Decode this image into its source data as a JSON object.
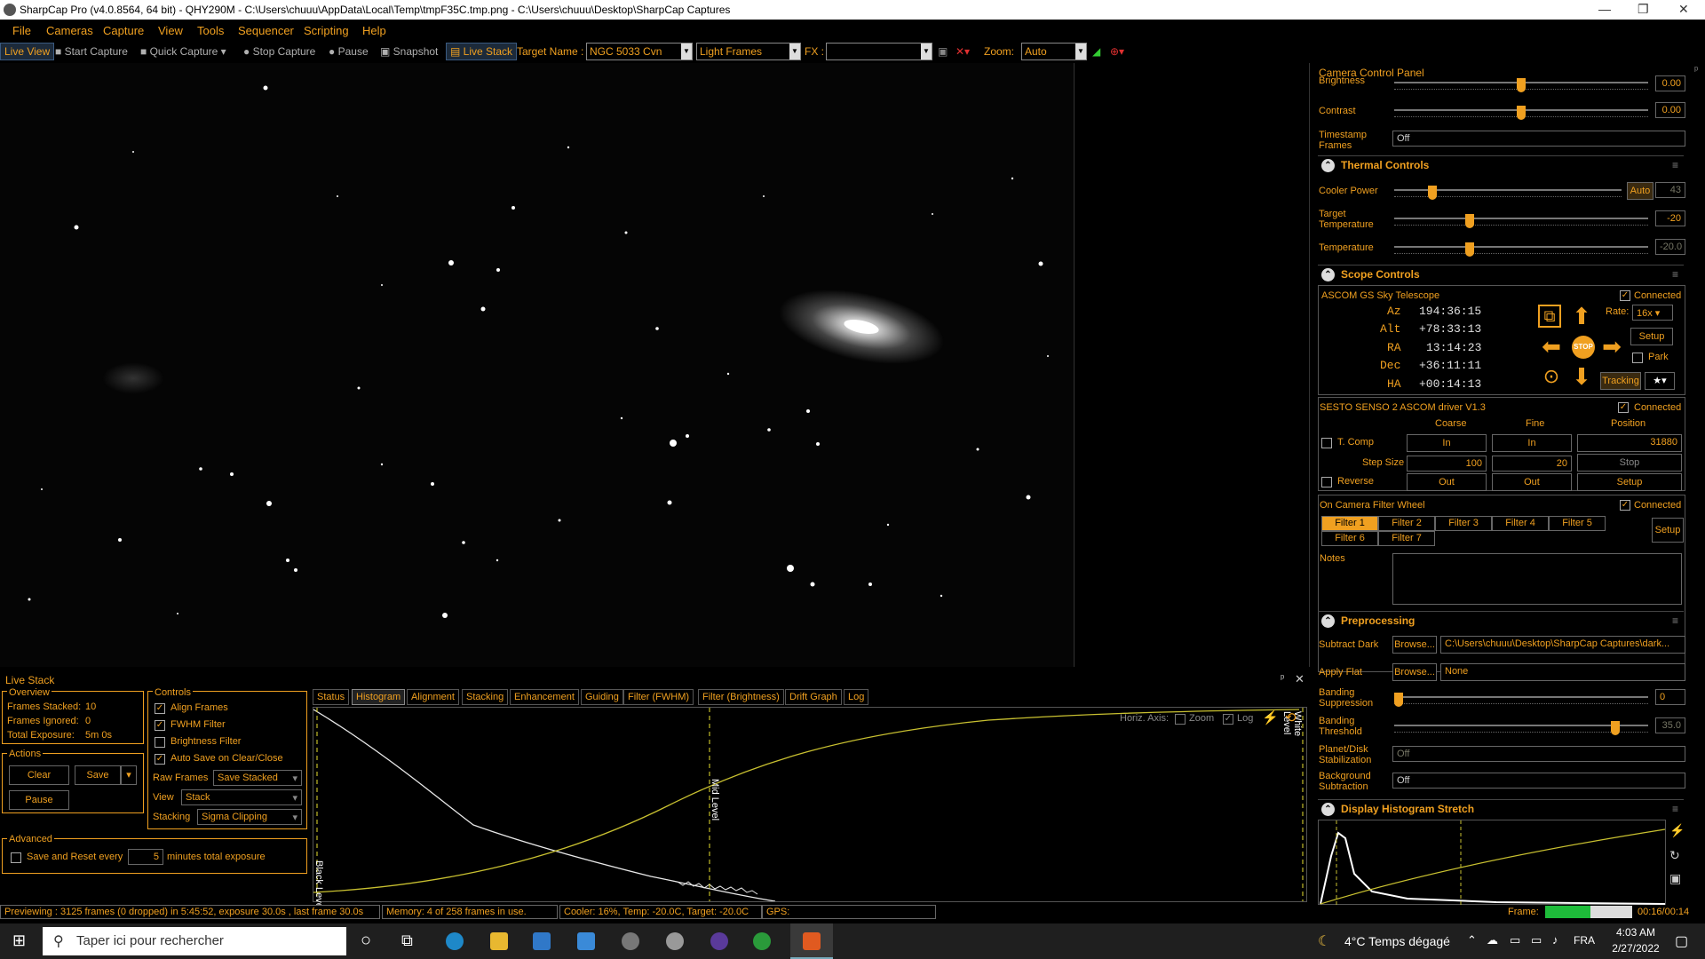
{
  "titlebar": {
    "title": "SharpCap Pro (v4.0.8564, 64 bit) - QHY290M - C:\\Users\\chuuu\\AppData\\Local\\Temp\\tmpF35C.tmp.png - C:\\Users\\chuuu\\Desktop\\SharpCap Captures"
  },
  "menu": [
    "File",
    "Cameras",
    "Capture",
    "View",
    "Tools",
    "Sequencer",
    "Scripting",
    "Help"
  ],
  "toolbar": {
    "live_view": "Live View",
    "start_capture": "Start Capture",
    "quick_capture": "Quick Capture",
    "stop_capture": "Stop Capture",
    "pause": "Pause",
    "snapshot": "Snapshot",
    "live_stack": "Live Stack",
    "target_name_label": "Target Name :",
    "target_name": "NGC 5033 Cvn",
    "frame_type": "Light Frames",
    "fx_label": "FX :",
    "fx_value": "",
    "zoom_label": "Zoom:",
    "zoom_value": "Auto"
  },
  "camera_panel": {
    "title": "Camera Control Panel",
    "brightness_label": "Brightness",
    "brightness_value": "0.00",
    "contrast_label": "Contrast",
    "contrast_value": "0.00",
    "timestamp_label": "Timestamp Frames",
    "timestamp_value": "Off"
  },
  "thermal": {
    "title": "Thermal Controls",
    "cooler_label": "Cooler Power",
    "cooler_auto": "Auto",
    "cooler_value": "43",
    "target_temp_label": "Target Temperature",
    "target_temp_value": "-20",
    "temp_label": "Temperature",
    "temp_value": "-20.0"
  },
  "scope": {
    "title": "Scope Controls",
    "name": "ASCOM GS Sky Telescope",
    "connected": "Connected",
    "az_label": "Az",
    "az": "194:36:15",
    "alt_label": "Alt",
    "alt": "+78:33:13",
    "ra_label": "RA",
    "ra": "13:14:23",
    "dec_label": "Dec",
    "dec": "+36:11:11",
    "ha_label": "HA",
    "ha": "+00:14:13",
    "rate_label": "Rate:",
    "rate": "16x",
    "setup": "Setup",
    "park": "Park",
    "stop": "STOP",
    "tracking": "Tracking"
  },
  "focuser": {
    "name": "SESTO SENSO 2 ASCOM driver V1.3",
    "connected": "Connected",
    "coarse": "Coarse",
    "fine": "Fine",
    "position": "Position",
    "tcomp": "T. Comp",
    "in": "In",
    "position_value": "31880",
    "step_size": "Step Size",
    "coarse_step": "100",
    "fine_step": "20",
    "stop": "Stop",
    "reverse": "Reverse",
    "out": "Out",
    "setup": "Setup"
  },
  "filterwheel": {
    "name": "On Camera Filter Wheel",
    "connected": "Connected",
    "filters": [
      "Filter 1",
      "Filter 2",
      "Filter 3",
      "Filter 4",
      "Filter 5",
      "Filter 6",
      "Filter 7"
    ],
    "setup": "Setup",
    "notes": "Notes"
  },
  "preproc": {
    "title": "Preprocessing",
    "subtract_dark": "Subtract Dark",
    "browse": "Browse...",
    "dark_path": "C:\\Users\\chuuu\\Desktop\\SharpCap Captures\\dark...",
    "apply_flat": "Apply Flat",
    "flat_value": "None",
    "banding_supp": "Banding Suppression",
    "banding_supp_value": "0",
    "banding_thr": "Banding Threshold",
    "banding_thr_value": "35.0",
    "planet_stab": "Planet/Disk Stabilization",
    "planet_stab_value": "Off",
    "bg_sub": "Background Subtraction",
    "bg_sub_value": "Off"
  },
  "histstretch": {
    "title": "Display Histogram Stretch"
  },
  "livestack": {
    "title": "Live Stack",
    "overview": "Overview",
    "frames_stacked_label": "Frames Stacked:",
    "frames_stacked": "10",
    "frames_ignored_label": "Frames Ignored:",
    "frames_ignored": "0",
    "total_exposure_label": "Total Exposure:",
    "total_exposure": "5m 0s",
    "actions": "Actions",
    "clear": "Clear",
    "save": "Save",
    "pause": "Pause",
    "controls": "Controls",
    "align": "Align Frames",
    "fwhm": "FWHM Filter",
    "brightness": "Brightness Filter",
    "autosave": "Auto Save on Clear/Close",
    "raw_frames_label": "Raw Frames",
    "raw_frames": "Save Stacked",
    "view_label": "View",
    "view": "Stack",
    "stacking_label": "Stacking",
    "stacking": "Sigma Clipping",
    "advanced": "Advanced",
    "save_reset": "Save and Reset every",
    "save_reset_value": "5",
    "minutes": "minutes total exposure",
    "tabs": [
      "Status",
      "Histogram",
      "Alignment",
      "Stacking",
      "Enhancement",
      "Guiding",
      "Filter (FWHM)",
      "Filter (Brightness)",
      "Drift Graph",
      "Log"
    ],
    "horiz_axis": "Horiz. Axis:",
    "zoom": "Zoom",
    "log": "Log",
    "black_level": "Black Level",
    "mid_level": "Mid Level",
    "white_level": "White Level"
  },
  "status": {
    "preview": "Previewing : 3125 frames (0 dropped) in 5:45:52, exposure 30.0s , last frame 30.0s",
    "memory": "Memory: 4 of 258 frames in use.",
    "cooler": "Cooler: 16%, Temp: -20.0C, Target: -20.0C",
    "gps": "GPS:",
    "frame_label": "Frame:",
    "frame_time": "00:16/00:14"
  },
  "taskbar": {
    "search": "Taper ici pour rechercher",
    "weather": "4°C  Temps dégagé",
    "lang": "FRA",
    "time": "4:03 AM",
    "date": "2/27/2022"
  }
}
